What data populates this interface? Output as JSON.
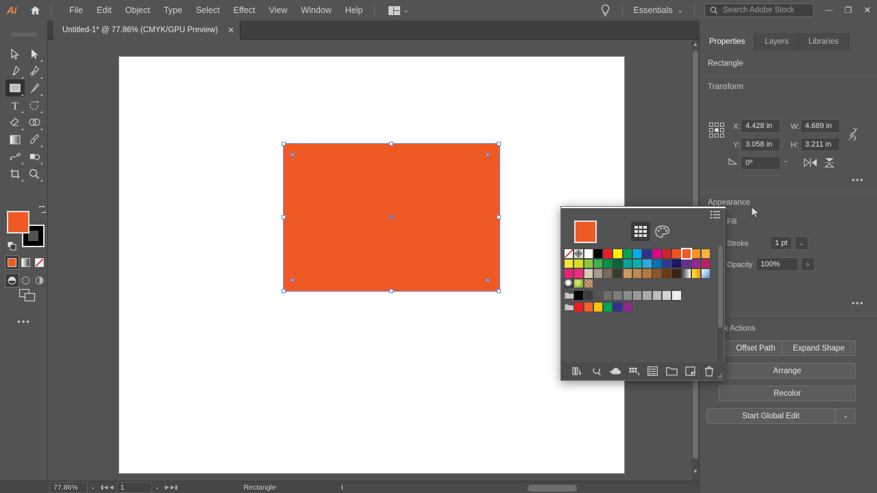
{
  "app": {
    "name": "Adobe Illustrator",
    "logo_text": "Ai",
    "home_icon": "home-icon"
  },
  "menubar": {
    "items": [
      "File",
      "Edit",
      "Object",
      "Type",
      "Select",
      "Effect",
      "View",
      "Window",
      "Help"
    ],
    "arrange_icon": "arrange-documents-icon",
    "arrange_caret": "⌄",
    "bulb_icon": "search-help-bulb-icon",
    "workspace": "Essentials",
    "workspace_caret": "⌄",
    "search": {
      "placeholder": "Search Adobe Stock",
      "value": "",
      "icon": "search-icon"
    },
    "window_controls": {
      "minimize": "—",
      "restore": "❐",
      "close": "✕"
    }
  },
  "tabbar": {
    "document_title": "Untitled-1* @ 77.86% (CMYK/GPU Preview)",
    "close_glyph": "✕",
    "collapse_left": "«",
    "collapse_right": "»"
  },
  "toolbar": {
    "tools": [
      {
        "name": "selection-tool",
        "icon": "arrow-cursor",
        "active": false,
        "has_flyout": false
      },
      {
        "name": "direct-selection-tool",
        "icon": "white-arrow-cursor",
        "active": false,
        "has_flyout": true
      },
      {
        "name": "pen-tool",
        "icon": "pen",
        "active": false,
        "has_flyout": true
      },
      {
        "name": "curvature-tool",
        "icon": "curvature-pen",
        "active": false,
        "has_flyout": true
      },
      {
        "name": "rectangle-tool",
        "icon": "rectangle",
        "active": true,
        "has_flyout": true
      },
      {
        "name": "paintbrush-tool",
        "icon": "paintbrush",
        "active": false,
        "has_flyout": true
      },
      {
        "name": "type-tool",
        "icon": "type-T",
        "active": false,
        "has_flyout": true
      },
      {
        "name": "rotate-tool",
        "icon": "rotate-arrow",
        "active": false,
        "has_flyout": true
      },
      {
        "name": "eraser-tool",
        "icon": "eraser",
        "active": false,
        "has_flyout": true
      },
      {
        "name": "shape-builder-tool",
        "icon": "shape-builder",
        "active": false,
        "has_flyout": true
      },
      {
        "name": "gradient-tool",
        "icon": "gradient-square",
        "active": false,
        "has_flyout": false
      },
      {
        "name": "eyedropper-tool",
        "icon": "eyedropper",
        "active": false,
        "has_flyout": true
      },
      {
        "name": "blend-tool",
        "icon": "blend",
        "active": false,
        "has_flyout": true
      },
      {
        "name": "symbol-sprayer-tool",
        "icon": "symbol-sprayer",
        "active": false,
        "has_flyout": true
      },
      {
        "name": "artboard-tool",
        "icon": "artboard-crop",
        "active": false,
        "has_flyout": true
      },
      {
        "name": "zoom-tool",
        "icon": "magnifier",
        "active": false,
        "has_flyout": true
      }
    ],
    "fill_color": "#ef5a24",
    "stroke_color": "#000000",
    "swap_icon": "swap-fill-stroke-icon",
    "default_icon": "default-fill-stroke-icon",
    "color_modes": [
      {
        "name": "color-mode-button",
        "icon": "solid-color",
        "active": true
      },
      {
        "name": "gradient-mode-button",
        "icon": "gradient",
        "active": false
      },
      {
        "name": "none-mode-button",
        "icon": "none-slash",
        "active": false
      }
    ],
    "draw_modes": [
      {
        "name": "draw-normal-button",
        "icon": "draw-normal",
        "active": true
      },
      {
        "name": "draw-behind-button",
        "icon": "draw-behind",
        "active": false
      },
      {
        "name": "draw-inside-button",
        "icon": "draw-inside",
        "active": false
      }
    ],
    "screen_mode": {
      "name": "change-screen-mode-button",
      "icon": "screen-mode"
    },
    "more_tools": "•••"
  },
  "canvas": {
    "artboard_color": "#ffffff",
    "shape": {
      "name": "Rectangle",
      "fill": "#ef5a24",
      "selection_color": "#6f7fc9"
    }
  },
  "statusbar": {
    "zoom": "77.86%",
    "zoom_caret": "⌄",
    "page_first": "⏮",
    "page_prev": "◀",
    "page_number": "1",
    "page_caret": "⌄",
    "page_next": "▶",
    "page_last": "⏭",
    "current_tool": "Rectangle",
    "play_glyph": "▶",
    "left_glyph": "‹"
  },
  "properties_panel": {
    "tabs": [
      {
        "label": "Properties",
        "active": true
      },
      {
        "label": "Layers",
        "active": false
      },
      {
        "label": "Libraries",
        "active": false
      }
    ],
    "object_type": "Rectangle",
    "transform": {
      "title": "Transform",
      "reference_point_icon": "reference-point-grid-icon",
      "x_label": "X:",
      "x_value": "4.428 in",
      "y_label": "Y:",
      "y_value": "3.058 in",
      "w_label": "W:",
      "w_value": "4.689 in",
      "h_label": "H:",
      "h_value": "3.211 in",
      "link_icon": "constrain-proportions-icon",
      "angle_icon": "shear-angle-icon",
      "angle_value": "0º",
      "angle_caret": "⌄",
      "flip_h_icon": "flip-horizontal-icon",
      "flip_v_icon": "flip-vertical-icon",
      "more_options": "•••"
    },
    "appearance": {
      "title": "Appearance",
      "fill_label": "Fill",
      "fill_color": "#ffffff",
      "list_icon": "appearance-list-icon",
      "stroke_label": "Stroke",
      "stroke_weight": "1 pt",
      "stroke_stepper_icon": "stepper-icon",
      "stroke_caret": "⌄",
      "opacity_label": "Opacity",
      "opacity_value": "100%",
      "opacity_arrow": "›",
      "more_options": "•••"
    },
    "quick_actions": {
      "title": "Quick Actions",
      "buttons": [
        "Offset Path",
        "Expand Shape",
        "Arrange",
        "Recolor"
      ],
      "global_edit": "Start Global Edit",
      "global_edit_caret": "⌄"
    }
  },
  "swatches_panel": {
    "preview_color": "#ef5a24",
    "swatch_libraries_icon": "swatch-grid-icon",
    "color_mixer_icon": "color-palette-icon",
    "menu_icon": "panel-menu-icon",
    "rows": [
      [
        "#ffffff:none",
        "#cfcfcf:registration",
        "#ffffff",
        "#000000",
        "#ed1c24",
        "#fff200",
        "#00a651",
        "#00aeef",
        "#2e3192",
        "#ec008c",
        "#d62027",
        "#f4511e",
        "#ef5a24:selected",
        "#f7941e",
        "#fbb040"
      ],
      [
        "#f2e733",
        "#d7df23",
        "#8dc63f",
        "#39b54a",
        "#009444",
        "#006838",
        "#00a69c",
        "#00b3ad",
        "#29abe2",
        "#0071bc",
        "#2b3990",
        "#1b1464",
        "#662d91",
        "#92278f",
        "#be1e66"
      ],
      [
        "#ec2176",
        "#ee2a7b",
        "#d6cdb7",
        "#a79b8e",
        "#7a6a5d",
        "#3a3a2a",
        "#c99a62",
        "#c08b4e",
        "#b57b3c",
        "#93572a",
        "#6b3a18",
        "#3b2314",
        "#e9e9e9",
        "#fcb813",
        "#7aa6dd"
      ],
      [
        "#f0f0f0:gradient-circle",
        "#8cc63f:gradient-green",
        "#cba07a:gradient-tan"
      ],
      [
        "#5a5a5a:folder",
        "#000000",
        "#3d3d3d",
        "#4d4d4d",
        "#6e6e6e",
        "#7c7c7c",
        "#8d8d8d",
        "#9b9b9b",
        "#aaaaaa",
        "#bdbdbd",
        "#d4d4d4",
        "#eeeeee"
      ],
      [
        "#5a5a5a:folder",
        "#ed1c24",
        "#f26522",
        "#fdc60b",
        "#00a651",
        "#2e3192",
        "#92278f"
      ]
    ],
    "footer_buttons": [
      {
        "name": "swatch-libraries-menu-button",
        "icon": "books-icon"
      },
      {
        "name": "show-swatch-kinds-menu-button",
        "icon": "filter-icon"
      },
      {
        "name": "swatch-options-button",
        "icon": "cloud-plus-icon"
      },
      {
        "name": "new-color-group-button",
        "icon": "grid-folder-icon"
      },
      {
        "name": "swatch-list-button",
        "icon": "list-icon"
      },
      {
        "name": "new-group-button",
        "icon": "folder-icon"
      },
      {
        "name": "new-swatch-button",
        "icon": "new-page-icon"
      },
      {
        "name": "delete-swatch-button",
        "icon": "trash-icon"
      }
    ]
  }
}
